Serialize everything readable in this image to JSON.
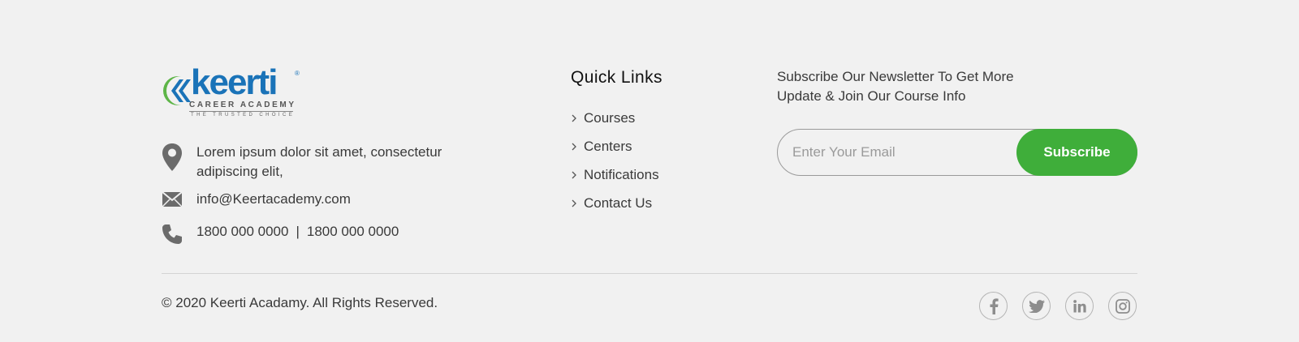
{
  "brand": {
    "name": "keerti",
    "registered_mark": "®",
    "subtitle": "CAREER ACADEMY",
    "tagline": "THE TRUSTED CHOICE",
    "colors": {
      "primary_blue": "#1a73b8",
      "green": "#5db547"
    }
  },
  "contact": {
    "address_line1": "Lorem ipsum dolor sit amet, consectetur",
    "address_line2": "adipiscing elit,",
    "email": "info@Keertacademy.com",
    "phone1": "1800 000 0000",
    "phone_separator": "|",
    "phone2": "1800 000 0000",
    "icons": [
      "location-pin-icon",
      "envelope-icon",
      "phone-icon"
    ]
  },
  "quick_links": {
    "title": "Quick Links",
    "items": [
      {
        "label": "Courses"
      },
      {
        "label": "Centers"
      },
      {
        "label": "Notifications"
      },
      {
        "label": "Contact Us"
      }
    ]
  },
  "newsletter": {
    "text_line1": "Subscribe Our Newsletter To Get More",
    "text_line2": "Update & Join Our Course Info",
    "email_placeholder": "Enter Your Email",
    "email_value": "",
    "button_label": "Subscribe",
    "button_color": "#3fae3a"
  },
  "bottom": {
    "copyright": "© 2020 Keerti Acadamy. All Rights Reserved.",
    "socials": [
      "facebook-icon",
      "twitter-icon",
      "linkedin-icon",
      "instagram-icon"
    ]
  }
}
